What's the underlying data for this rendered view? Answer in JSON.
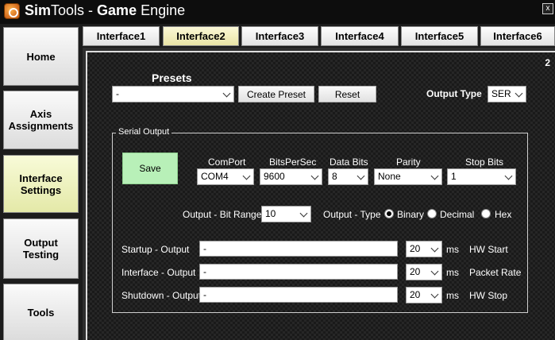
{
  "titlebar": {
    "title_a": "Sim",
    "title_b": "Tools",
    "title_sep": " - ",
    "title_c": "Game",
    "title_d": " Engine",
    "close": "x"
  },
  "sidebar": {
    "items": [
      {
        "label": "Home"
      },
      {
        "label": "Axis Assignments"
      },
      {
        "label": "Interface Settings"
      },
      {
        "label": "Output Testing"
      },
      {
        "label": "Tools"
      }
    ]
  },
  "tabs": [
    {
      "label": "Interface1"
    },
    {
      "label": "Interface2"
    },
    {
      "label": "Interface3"
    },
    {
      "label": "Interface4"
    },
    {
      "label": "Interface5"
    },
    {
      "label": "Interface6"
    }
  ],
  "panel": {
    "number": "2",
    "presets_label": "Presets",
    "preset_value": "-",
    "create_preset": "Create Preset",
    "reset": "Reset",
    "output_type_label": "Output Type",
    "output_type_value": "SER",
    "serial_legend": "Serial Output",
    "save": "Save",
    "comport_label": "ComPort",
    "comport_value": "COM4",
    "bps_label": "BitsPerSec",
    "bps_value": "9600",
    "databits_label": "Data Bits",
    "databits_value": "8",
    "parity_label": "Parity",
    "parity_value": "None",
    "stopbits_label": "Stop Bits",
    "stopbits_value": "1",
    "bitrange_label": "Output - Bit Range",
    "bitrange_value": "10",
    "outtype_label": "Output - Type",
    "radio_binary": "Binary",
    "radio_decimal": "Decimal",
    "radio_hex": "Hex",
    "startup_label": "Startup - Output",
    "startup_value": "-",
    "startup_ms": "20",
    "startup_desc": "HW Start",
    "interface_label": "Interface - Output",
    "interface_value": "-",
    "interface_ms": "20",
    "interface_desc": "Packet Rate",
    "shutdown_label": "Shutdown - Output",
    "shutdown_value": "-",
    "shutdown_ms": "20",
    "shutdown_desc": "HW Stop",
    "ms_unit": "ms"
  }
}
